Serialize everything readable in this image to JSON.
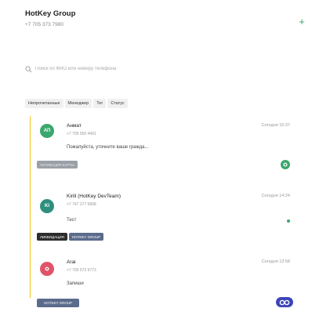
{
  "header": {
    "org_name": "HotKey Group",
    "org_phone": "+7 705 373 7980",
    "add_label": "+"
  },
  "search": {
    "placeholder": "Поиск по ФИО или номеру телефона"
  },
  "filters": [
    {
      "label": "Непрочитанные"
    },
    {
      "label": "Менеджер"
    },
    {
      "label": "Тег"
    },
    {
      "label": "Статус"
    }
  ],
  "conversations": [
    {
      "avatar_initials": "АП",
      "name": "Анмат",
      "phone": "+7 705 555 4491",
      "time": "Сегодня 15:37",
      "message": "Пожалуйста, уточните ваше граждa..."
    },
    {
      "avatar_initials": "KI",
      "name": "Kirill (HotKey DevTeam)",
      "phone": "+7 747 277 6808",
      "time": "Сегодня 14:24",
      "message": "Тест"
    },
    {
      "avatar_initials": "",
      "name": "Arai",
      "phone": "+7 705 573 9773",
      "time": "Сегодня 13:58",
      "message": "Запиши"
    }
  ],
  "tags": {
    "card_activation": "Активация карты",
    "liquidation": "Ликвидация",
    "hotkey_group": "Hotkey group",
    "hotkey_group_2": "Hotkey group"
  },
  "colors": {
    "green": "#3aa76d",
    "teal": "#2f8f7e",
    "pink": "#e0546a",
    "tag_gray": "#9aa0a6",
    "tag_dark": "#2d2d2d",
    "tag_blue": "#5b6b8c",
    "yellow": "#f5c518",
    "indigo": "#3c45b8"
  },
  "icons": {
    "add": "plus-icon",
    "search": "search-icon"
  }
}
